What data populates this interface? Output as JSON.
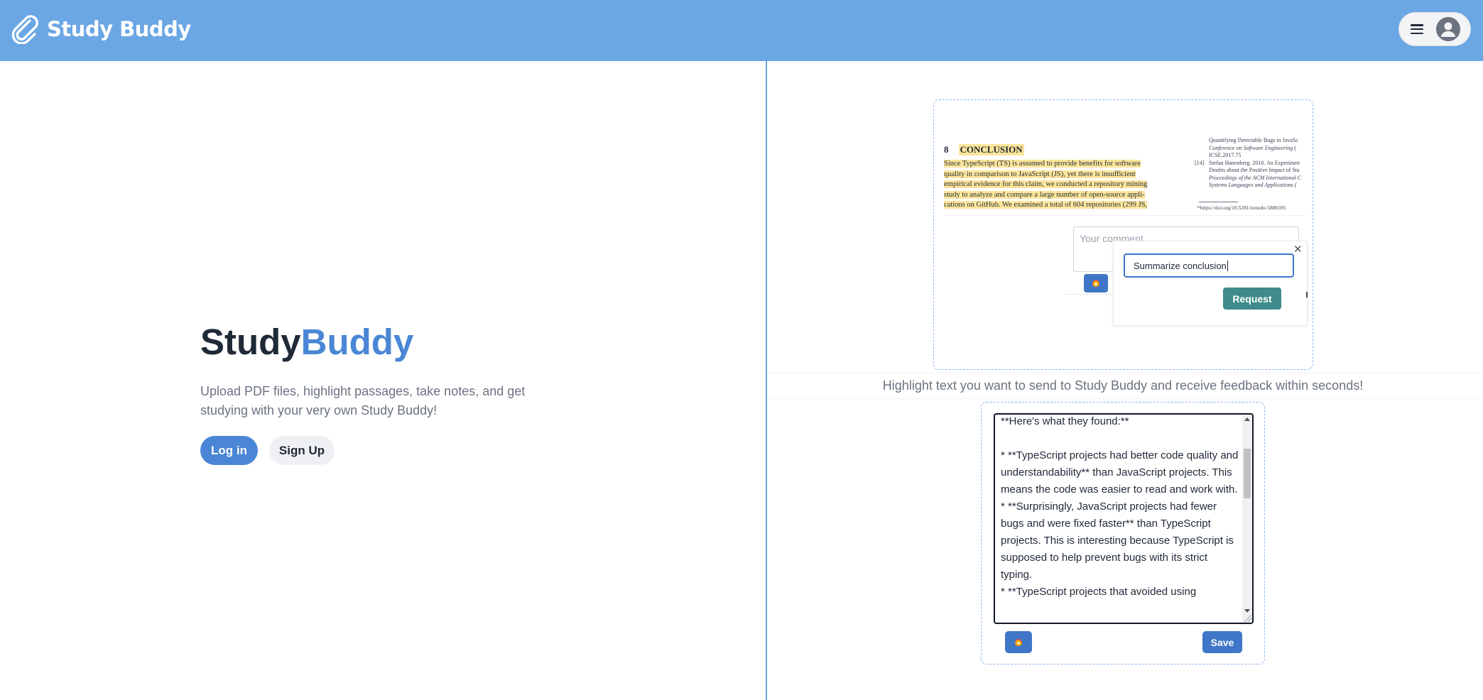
{
  "header": {
    "app_name": "Study Buddy",
    "logo_icon": "paperclip-icon",
    "menu_icon": "hamburger-icon",
    "profile_icon": "user-avatar-icon"
  },
  "hero": {
    "title_part1": "Study",
    "title_part2": "Buddy",
    "subtitle": "Upload PDF files, highlight passages, take notes, and get studying with your very own Study Buddy!",
    "login_label": "Log in",
    "signup_label": "Sign Up"
  },
  "demo": {
    "pdf": {
      "section_number": "8",
      "section_title": "CONCLUSION",
      "paragraph_lines": [
        "Since TypeScript (TS) is assumed to provide benefits for software",
        "quality in comparison to JavaScript (JS), yet there is insufficient",
        "empirical evidence for this claim, we conducted a repository mining",
        "study to analyze and compare a large number of open-source appli-",
        "cations on GitHub. We examined a total of 604 repositories (299 JS,"
      ],
      "refs": {
        "line1": "Quantifying Detectable Bugs in JavaSc",
        "line2": "Conference on Software Engineering (",
        "line3": "ICSE.2017.75",
        "num14": "[14]",
        "line4": "Stefan Hanenberg. 2010. An Experimen",
        "line5": "Doubts about the Positive Impact of Sta",
        "line6": "Proceedings of the ACM International C",
        "line7": "Systems Languages and Applications (",
        "footnote": "¹⁵https://doi.org/10.5281/zenodo.5886595"
      }
    },
    "comment_placeholder": "Your comment",
    "request_input_value": "Summarize conclusion",
    "request_button_label": "Request",
    "close_glyph": "✕"
  },
  "caption": "Highlight text you want to send to Study Buddy and receive feedback within seconds!",
  "response": {
    "text": "**Here's what they found:**\n\n* **TypeScript projects had better code quality and understandability** than JavaScript projects. This means the code was easier to read and work with.\n* **Surprisingly, JavaScript projects had fewer bugs and were fixed faster** than TypeScript projects. This is interesting because TypeScript is supposed to help prevent bugs with its strict typing.\n* **TypeScript projects that avoided using",
    "save_label": "Save",
    "flame_icon": "flame-icon"
  },
  "colors": {
    "header_bg": "#6ba6e5",
    "accent": "#4a86d5",
    "highlight": "#fde59a",
    "request_button": "#3f8a8a"
  }
}
